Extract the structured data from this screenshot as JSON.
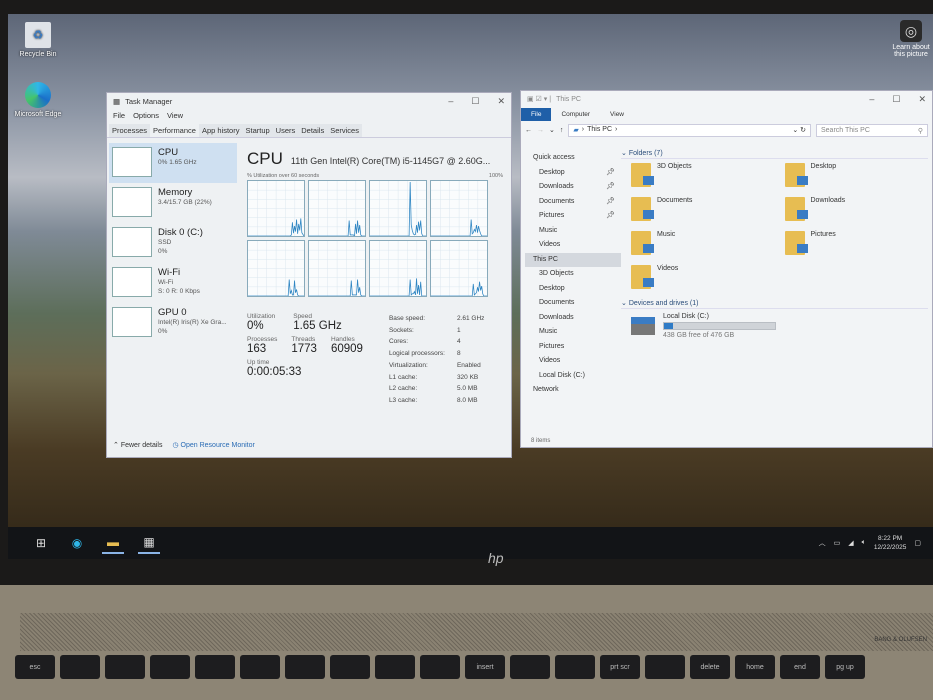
{
  "desktop": {
    "icons": [
      {
        "label": "Recycle Bin"
      },
      {
        "label": "Microsoft Edge"
      }
    ],
    "spotlight": "Learn about this picture"
  },
  "task_manager": {
    "title": "Task Manager",
    "menu": [
      "File",
      "Options",
      "View"
    ],
    "tabs": [
      "Processes",
      "Performance",
      "App history",
      "Startup",
      "Users",
      "Details",
      "Services"
    ],
    "active_tab": "Performance",
    "sidebar": [
      {
        "name": "CPU",
        "sub1": "0% 1.65 GHz",
        "sub2": "",
        "sub3": ""
      },
      {
        "name": "Memory",
        "sub1": "3.4/15.7 GB (22%)",
        "sub2": "",
        "sub3": ""
      },
      {
        "name": "Disk 0 (C:)",
        "sub1": "SSD",
        "sub2": "0%",
        "sub3": ""
      },
      {
        "name": "Wi-Fi",
        "sub1": "Wi-Fi",
        "sub2": "S: 0 R: 0 Kbps",
        "sub3": ""
      },
      {
        "name": "GPU 0",
        "sub1": "Intel(R) Iris(R) Xe Gra...",
        "sub2": "0%",
        "sub3": ""
      }
    ],
    "heading": "CPU",
    "model": "11th Gen Intel(R) Core(TM) i5-1145G7 @ 2.60G...",
    "graph_caption": "% Utilization over 60 seconds",
    "graph_max": "100%",
    "core_graphs": [
      [
        0,
        0,
        0,
        0,
        0,
        0,
        0,
        0,
        0,
        0,
        0,
        0,
        0,
        0,
        0,
        0,
        0,
        0,
        0,
        0,
        0,
        0,
        0,
        0,
        0,
        0,
        0,
        0,
        0,
        0,
        0,
        0,
        0,
        0,
        0,
        0,
        0,
        0,
        0,
        0,
        0,
        2,
        25,
        5,
        18,
        8,
        30,
        4,
        22,
        10,
        32,
        6,
        3,
        0
      ],
      [
        0,
        0,
        0,
        0,
        0,
        0,
        0,
        0,
        0,
        0,
        0,
        0,
        0,
        0,
        0,
        0,
        0,
        0,
        0,
        0,
        0,
        0,
        0,
        0,
        0,
        0,
        0,
        0,
        0,
        0,
        0,
        0,
        0,
        0,
        0,
        0,
        0,
        0,
        28,
        2,
        2,
        2,
        2,
        0,
        22,
        4,
        28,
        6,
        20,
        2,
        0,
        0,
        0,
        0
      ],
      [
        0,
        0,
        0,
        0,
        0,
        0,
        0,
        0,
        0,
        0,
        0,
        0,
        0,
        0,
        0,
        0,
        0,
        0,
        0,
        0,
        0,
        0,
        0,
        0,
        0,
        0,
        0,
        0,
        0,
        0,
        0,
        0,
        0,
        0,
        0,
        0,
        0,
        0,
        98,
        20,
        10,
        4,
        2,
        3,
        20,
        6,
        26,
        10,
        28,
        4,
        0,
        0,
        0,
        0
      ],
      [
        0,
        0,
        0,
        0,
        0,
        0,
        0,
        0,
        0,
        0,
        0,
        0,
        0,
        0,
        0,
        0,
        0,
        0,
        0,
        0,
        0,
        0,
        0,
        0,
        0,
        0,
        0,
        0,
        0,
        0,
        0,
        0,
        0,
        0,
        0,
        0,
        0,
        0,
        30,
        4,
        6,
        12,
        8,
        20,
        6,
        18,
        10,
        4,
        0,
        0,
        0,
        0,
        0,
        0
      ],
      [
        0,
        0,
        0,
        0,
        0,
        0,
        0,
        0,
        0,
        0,
        0,
        0,
        0,
        0,
        0,
        0,
        0,
        0,
        0,
        0,
        0,
        0,
        0,
        0,
        0,
        0,
        0,
        0,
        0,
        0,
        0,
        0,
        0,
        0,
        0,
        0,
        0,
        0,
        0,
        30,
        4,
        10,
        2,
        2,
        28,
        6,
        12,
        2,
        0,
        0,
        0,
        0,
        0,
        0
      ],
      [
        0,
        0,
        0,
        0,
        0,
        0,
        0,
        0,
        0,
        0,
        0,
        0,
        0,
        0,
        0,
        0,
        0,
        0,
        0,
        0,
        0,
        0,
        0,
        0,
        0,
        0,
        0,
        0,
        0,
        0,
        0,
        0,
        0,
        0,
        0,
        0,
        0,
        0,
        0,
        0,
        28,
        2,
        2,
        2,
        2,
        2,
        30,
        6,
        16,
        2,
        0,
        0,
        0,
        0
      ],
      [
        0,
        0,
        0,
        0,
        0,
        0,
        0,
        0,
        0,
        0,
        0,
        0,
        0,
        0,
        0,
        0,
        0,
        0,
        0,
        0,
        0,
        0,
        0,
        0,
        0,
        0,
        0,
        0,
        0,
        0,
        0,
        0,
        0,
        0,
        0,
        0,
        0,
        0,
        30,
        2,
        4,
        4,
        8,
        2,
        32,
        4,
        20,
        2,
        26,
        0,
        0,
        0,
        0,
        0
      ],
      [
        0,
        0,
        0,
        0,
        0,
        0,
        0,
        0,
        0,
        0,
        0,
        0,
        0,
        0,
        0,
        0,
        0,
        0,
        0,
        0,
        0,
        0,
        0,
        0,
        0,
        0,
        0,
        0,
        0,
        0,
        0,
        0,
        0,
        0,
        0,
        0,
        0,
        0,
        0,
        0,
        22,
        2,
        4,
        6,
        16,
        8,
        26,
        10,
        18,
        4,
        0,
        0,
        0,
        0
      ]
    ],
    "stats": {
      "utilization_label": "Utilization",
      "utilization": "0%",
      "speed_label": "Speed",
      "speed": "1.65 GHz",
      "processes_label": "Processes",
      "processes": "163",
      "threads_label": "Threads",
      "threads": "1773",
      "handles_label": "Handles",
      "handles": "60909",
      "uptime_label": "Up time",
      "uptime": "0:00:05:33"
    },
    "specs": [
      {
        "k": "Base speed:",
        "v": "2.61 GHz"
      },
      {
        "k": "Sockets:",
        "v": "1"
      },
      {
        "k": "Cores:",
        "v": "4"
      },
      {
        "k": "Logical processors:",
        "v": "8"
      },
      {
        "k": "Virtualization:",
        "v": "Enabled"
      },
      {
        "k": "L1 cache:",
        "v": "320 KB"
      },
      {
        "k": "L2 cache:",
        "v": "5.0 MB"
      },
      {
        "k": "L3 cache:",
        "v": "8.0 MB"
      }
    ],
    "fewer_details": "Fewer details",
    "open_resource_monitor": "Open Resource Monitor"
  },
  "explorer": {
    "title": "This PC",
    "ribbon": [
      "File",
      "Computer",
      "View"
    ],
    "address": "This PC",
    "search_placeholder": "Search This PC",
    "nav": [
      {
        "label": "Quick access",
        "level": 0
      },
      {
        "label": "Desktop",
        "level": 1,
        "pin": true
      },
      {
        "label": "Downloads",
        "level": 1,
        "pin": true
      },
      {
        "label": "Documents",
        "level": 1,
        "pin": true
      },
      {
        "label": "Pictures",
        "level": 1,
        "pin": true
      },
      {
        "label": "Music",
        "level": 1
      },
      {
        "label": "Videos",
        "level": 1
      },
      {
        "label": "This PC",
        "level": 0,
        "selected": true
      },
      {
        "label": "3D Objects",
        "level": 1
      },
      {
        "label": "Desktop",
        "level": 1
      },
      {
        "label": "Documents",
        "level": 1
      },
      {
        "label": "Downloads",
        "level": 1
      },
      {
        "label": "Music",
        "level": 1
      },
      {
        "label": "Pictures",
        "level": 1
      },
      {
        "label": "Videos",
        "level": 1
      },
      {
        "label": "Local Disk (C:)",
        "level": 1
      },
      {
        "label": "Network",
        "level": 0
      }
    ],
    "folders_header": "Folders (7)",
    "folders": [
      "3D Objects",
      "Desktop",
      "Documents",
      "Downloads",
      "Music",
      "Pictures",
      "Videos"
    ],
    "drives_header": "Devices and drives (1)",
    "drive": {
      "name": "Local Disk (C:)",
      "free": "438 GB free of 476 GB",
      "used_fraction": 0.08
    },
    "status": "8 items"
  },
  "taskbar": {
    "time": "8:22 PM",
    "date": "12/22/2025"
  },
  "laptop": {
    "logo": "hp",
    "speaker_brand": "BANG & OLUFSEN",
    "keys": [
      "esc",
      "",
      "",
      "",
      "",
      "",
      "",
      "",
      "",
      "",
      "insert",
      "",
      "",
      "prt scr",
      "",
      "delete",
      "home",
      "end",
      "pg up"
    ]
  }
}
